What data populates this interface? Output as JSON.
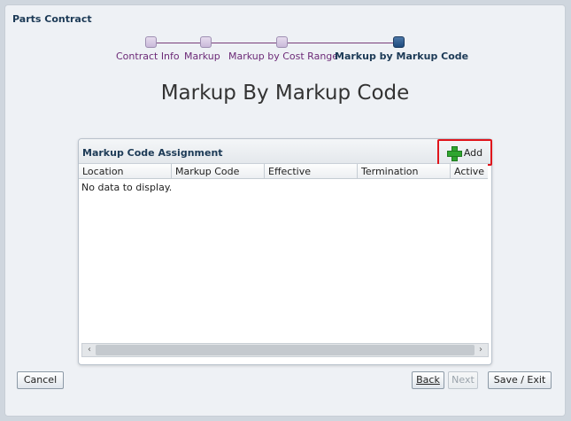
{
  "window": {
    "title": "Parts Contract"
  },
  "train": {
    "stops": [
      {
        "label": "Contract Info",
        "current": false
      },
      {
        "label": "Markup",
        "current": false
      },
      {
        "label": "Markup by Cost Range",
        "current": false
      },
      {
        "label": "Markup by Markup Code",
        "current": true
      }
    ]
  },
  "page": {
    "title": "Markup By Markup Code"
  },
  "panel": {
    "title": "Markup Code Assignment",
    "add_label": "Add",
    "columns": [
      "Location",
      "Markup Code",
      "Effective",
      "Termination",
      "Active"
    ],
    "empty_message": "No data to display."
  },
  "footer": {
    "cancel_label": "Cancel",
    "back_label": "Back",
    "next_label": "Next",
    "save_exit_label": "Save / Exit"
  }
}
